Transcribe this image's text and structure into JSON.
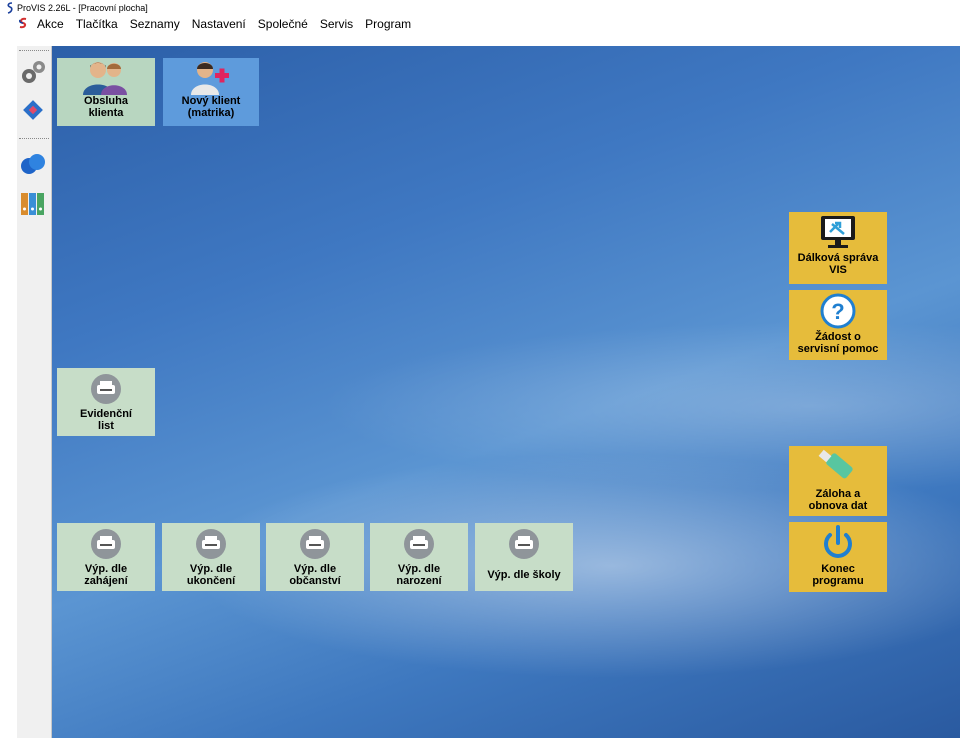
{
  "window": {
    "title": "ProVIS 2.26L - [Pracovní plocha]"
  },
  "menu": {
    "items": [
      "Akce",
      "Tlačítka",
      "Seznamy",
      "Nastavení",
      "Společné",
      "Servis",
      "Program"
    ]
  },
  "toolbar": {
    "icons": [
      "gears-icon",
      "network-icon",
      "chat-bubbles-icon",
      "binders-icon"
    ]
  },
  "tiles": {
    "obsluha": "Obsluha\nklienta",
    "novy": "Nový klient\n(matrika)",
    "evidencni": "Evidenční\nlist",
    "vyp_zahajeni": "Výp. dle\nzahájení",
    "vyp_ukonceni": "Výp. dle\nukončení",
    "vyp_obcanstvi": "Výp. dle\nobčanství",
    "vyp_narozeni": "Výp. dle\nnarození",
    "vyp_skoly": "Výp. dle školy",
    "dalkova": "Dálková správa\nVIS",
    "zadost": "Žádost o\nservisní pomoc",
    "zaloha": "Záloha a\nobnova dat",
    "konec": "Konec\nprogramu"
  },
  "colors": {
    "tile_green": "#b8d6c0",
    "tile_blue": "#5e9bdc",
    "tile_yellow": "#e6bc3b",
    "desktop": "#3f78c2"
  }
}
